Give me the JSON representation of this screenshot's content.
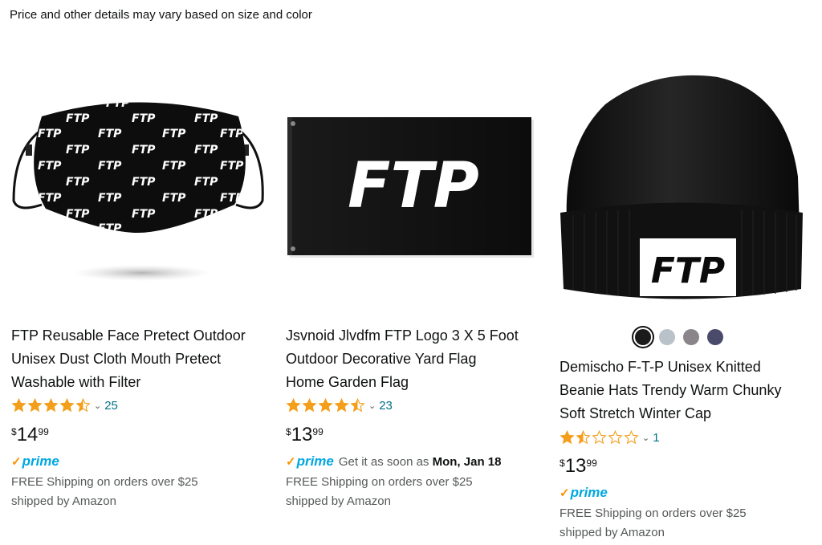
{
  "notice": "Price and other details may vary based on size and color",
  "products": [
    {
      "image_text": "FTP",
      "title_lines": [
        "FTP Reusable Face Pretect Outdoor",
        "Unisex Dust Cloth Mouth Pretect",
        "Washable with Filter"
      ],
      "rating": 4.5,
      "review_count": "25",
      "price_currency": "$",
      "price_whole": "14",
      "price_fraction": "99",
      "prime_label": "prime",
      "delivery_prefix": "",
      "delivery_date": "",
      "shipping_line": "FREE Shipping on orders over $25",
      "shipped_by": "shipped by Amazon"
    },
    {
      "image_text": "FTP",
      "title_lines": [
        "Jsvnoid Jlvdfm FTP Logo 3 X 5 Foot",
        "Outdoor Decorative Yard Flag",
        "Home Garden Flag"
      ],
      "rating": 4.5,
      "review_count": "23",
      "price_currency": "$",
      "price_whole": "13",
      "price_fraction": "99",
      "prime_label": "prime",
      "delivery_prefix": "Get it as soon as",
      "delivery_date": "Mon, Jan 18",
      "shipping_line": "FREE Shipping on orders over $25",
      "shipped_by": "shipped by Amazon"
    },
    {
      "image_text": "FTP",
      "title_lines": [
        "Demischo F-T-P Unisex Knitted",
        "Beanie Hats Trendy Warm Chunky",
        "Soft Stretch Winter Cap"
      ],
      "rating": 1.5,
      "review_count": "1",
      "price_currency": "$",
      "price_whole": "13",
      "price_fraction": "99",
      "prime_label": "prime",
      "delivery_prefix": "",
      "delivery_date": "",
      "shipping_line": "FREE Shipping on orders over $25",
      "shipped_by": "shipped by Amazon",
      "swatches": [
        "#1a1a1a",
        "#b8c2c8",
        "#8a8588",
        "#4a4a6a"
      ]
    }
  ],
  "colors": {
    "star": "#f49f1c",
    "link": "#007185",
    "prime_blue": "#00a8e1",
    "prime_check": "#f79400"
  }
}
